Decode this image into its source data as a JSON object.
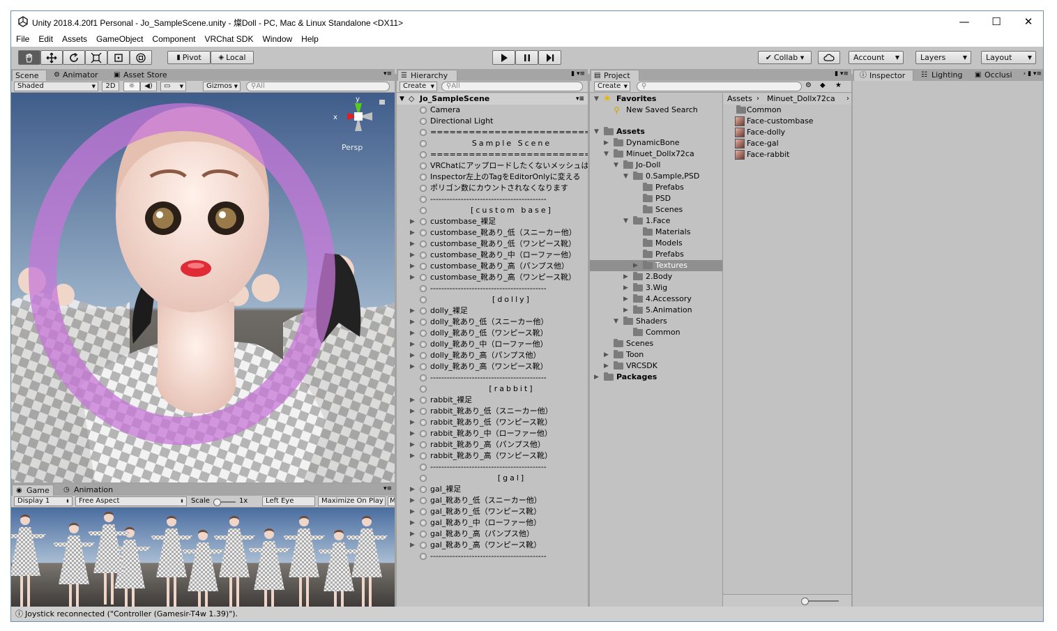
{
  "window": {
    "title": "Unity 2018.4.20f1 Personal - Jo_SampleScene.unity - 燦Doll - PC, Mac & Linux Standalone <DX11>",
    "minimize": "—",
    "maximize": "☐",
    "close": "✕"
  },
  "menu": [
    "File",
    "Edit",
    "Assets",
    "GameObject",
    "Component",
    "VRChat SDK",
    "Window",
    "Help"
  ],
  "toolbar": {
    "pivot": "Pivot",
    "local": "Local",
    "collab": "Collab ▾",
    "account": "Account",
    "layers": "Layers",
    "layout": "Layout"
  },
  "scene": {
    "tabs": [
      "Scene",
      "Animator",
      "Asset Store"
    ],
    "shading": "Shaded",
    "mode2d": "2D",
    "gizmos": "Gizmos",
    "search_placeholder": "All",
    "persp": "Persp",
    "axis_x": "x",
    "axis_y": "y"
  },
  "game": {
    "tabs": [
      "Game",
      "Animation"
    ],
    "display": "Display 1",
    "aspect": "Free Aspect",
    "scale_label": "Scale",
    "scale_value": "1x",
    "eye": "Left Eye",
    "maximize": "Maximize On Play",
    "trail": "M"
  },
  "hierarchy": {
    "tab": "Hierarchy",
    "create": "Create",
    "search_placeholder": "All",
    "scene_name": "Jo_SampleScene",
    "items": [
      {
        "label": "Camera",
        "exp": false
      },
      {
        "label": "Directional Light",
        "exp": false
      },
      {
        "label": "==========================",
        "exp": false
      },
      {
        "label": "Sample Scene",
        "exp": false,
        "center": true
      },
      {
        "label": "==========================",
        "exp": false
      },
      {
        "label": "VRChatにアップロードしたくないメッシュは",
        "exp": false
      },
      {
        "label": "Inspector左上のTagをEditorOnlyに変える",
        "exp": false
      },
      {
        "label": "ポリゴン数にカウントされなくなります",
        "exp": false
      },
      {
        "label": "------------------------------------------",
        "exp": false
      },
      {
        "label": "[custom base]",
        "exp": false,
        "center": true
      },
      {
        "label": "custombase_裸足",
        "exp": true
      },
      {
        "label": "custombase_靴あり_低（スニーカー他）",
        "exp": true
      },
      {
        "label": "custombase_靴あり_低（ワンピース靴）",
        "exp": true
      },
      {
        "label": "custombase_靴あり_中（ローファー他）",
        "exp": true
      },
      {
        "label": "custombase_靴あり_高（パンプス他）",
        "exp": true
      },
      {
        "label": "custombase_靴あり_高（ワンピース靴）",
        "exp": true
      },
      {
        "label": "------------------------------------------",
        "exp": false
      },
      {
        "label": "[dolly]",
        "exp": false,
        "center": true
      },
      {
        "label": "dolly_裸足",
        "exp": true
      },
      {
        "label": "dolly_靴あり_低（スニーカー他）",
        "exp": true
      },
      {
        "label": "dolly_靴あり_低（ワンピース靴）",
        "exp": true
      },
      {
        "label": "dolly_靴あり_中（ローファー他）",
        "exp": true
      },
      {
        "label": "dolly_靴あり_高（パンプス他）",
        "exp": true
      },
      {
        "label": "dolly_靴あり_高（ワンピース靴）",
        "exp": true
      },
      {
        "label": "------------------------------------------",
        "exp": false
      },
      {
        "label": "[rabbit]",
        "exp": false,
        "center": true
      },
      {
        "label": "rabbit_裸足",
        "exp": true
      },
      {
        "label": "rabbit_靴あり_低（スニーカー他）",
        "exp": true
      },
      {
        "label": "rabbit_靴あり_低（ワンピース靴）",
        "exp": true
      },
      {
        "label": "rabbit_靴あり_中（ローファー他）",
        "exp": true
      },
      {
        "label": "rabbit_靴あり_高（パンプス他）",
        "exp": true
      },
      {
        "label": "rabbit_靴あり_高（ワンピース靴）",
        "exp": true
      },
      {
        "label": "------------------------------------------",
        "exp": false
      },
      {
        "label": "[gal]",
        "exp": false,
        "center": true
      },
      {
        "label": "gal_裸足",
        "exp": true
      },
      {
        "label": "gal_靴あり_低（スニーカー他）",
        "exp": true
      },
      {
        "label": "gal_靴あり_低（ワンピース靴）",
        "exp": true
      },
      {
        "label": "gal_靴あり_中（ローファー他）",
        "exp": true
      },
      {
        "label": "gal_靴あり_高（パンプス他）",
        "exp": true
      },
      {
        "label": "gal_靴あり_高（ワンピース靴）",
        "exp": true
      },
      {
        "label": "------------------------------------------",
        "exp": false
      }
    ]
  },
  "project": {
    "tab": "Project",
    "create": "Create",
    "tree": [
      {
        "label": "Favorites",
        "bold": true,
        "tri": "▼",
        "lvl": 0,
        "kind": "star"
      },
      {
        "label": "New Saved Search",
        "lvl": 1,
        "kind": "search"
      },
      {
        "label": "",
        "lvl": 0,
        "kind": "gap"
      },
      {
        "label": "Assets",
        "bold": true,
        "tri": "▼",
        "lvl": 0,
        "kind": "folder"
      },
      {
        "label": "DynamicBone",
        "tri": "▶",
        "lvl": 1,
        "kind": "folder"
      },
      {
        "label": "Minuet_Dollx72ca",
        "tri": "▼",
        "lvl": 1,
        "kind": "folder"
      },
      {
        "label": "Jo-Doll",
        "tri": "▼",
        "lvl": 2,
        "kind": "folder"
      },
      {
        "label": "0.Sample,PSD",
        "tri": "▼",
        "lvl": 3,
        "kind": "folder"
      },
      {
        "label": "Prefabs",
        "lvl": 4,
        "kind": "folder"
      },
      {
        "label": "PSD",
        "lvl": 4,
        "kind": "folder"
      },
      {
        "label": "Scenes",
        "lvl": 4,
        "kind": "folder"
      },
      {
        "label": "1.Face",
        "tri": "▼",
        "lvl": 3,
        "kind": "folder"
      },
      {
        "label": "Materials",
        "lvl": 4,
        "kind": "folder"
      },
      {
        "label": "Models",
        "lvl": 4,
        "kind": "folder"
      },
      {
        "label": "Prefabs",
        "lvl": 4,
        "kind": "folder"
      },
      {
        "label": "Textures",
        "tri": "▶",
        "lvl": 4,
        "kind": "folder",
        "sel": true
      },
      {
        "label": "2.Body",
        "tri": "▶",
        "lvl": 3,
        "kind": "folder"
      },
      {
        "label": "3.Wig",
        "tri": "▶",
        "lvl": 3,
        "kind": "folder"
      },
      {
        "label": "4.Accessory",
        "tri": "▶",
        "lvl": 3,
        "kind": "folder"
      },
      {
        "label": "5.Animation",
        "tri": "▶",
        "lvl": 3,
        "kind": "folder"
      },
      {
        "label": "Shaders",
        "tri": "▼",
        "lvl": 2,
        "kind": "folder"
      },
      {
        "label": "Common",
        "lvl": 3,
        "kind": "folder"
      },
      {
        "label": "Scenes",
        "lvl": 1,
        "kind": "folder"
      },
      {
        "label": "Toon",
        "tri": "▶",
        "lvl": 1,
        "kind": "folder"
      },
      {
        "label": "VRCSDK",
        "tri": "▶",
        "lvl": 1,
        "kind": "folder"
      },
      {
        "label": "Packages",
        "bold": true,
        "tri": "▶",
        "lvl": 0,
        "kind": "folder"
      }
    ],
    "breadcrumb": [
      "Assets",
      "Minuet_Dollx72ca"
    ],
    "files": [
      {
        "label": "Common",
        "kind": "folder"
      },
      {
        "label": "Face-custombase",
        "kind": "tex"
      },
      {
        "label": "Face-dolly",
        "kind": "tex"
      },
      {
        "label": "Face-gal",
        "kind": "tex"
      },
      {
        "label": "Face-rabbit",
        "kind": "tex"
      }
    ]
  },
  "inspector": {
    "tabs": [
      "Inspector",
      "Lighting",
      "Occlusi"
    ]
  },
  "status": "Joystick reconnected (\"Controller (Gamesir-T4w 1.39)\")."
}
